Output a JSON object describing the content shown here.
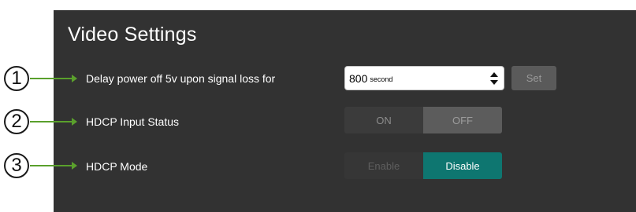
{
  "panel": {
    "title": "Video Settings"
  },
  "callouts": [
    "1",
    "2",
    "3"
  ],
  "rows": {
    "delay": {
      "label": "Delay power off 5v upon signal loss for",
      "value": "800",
      "unit": "second",
      "set_label": "Set"
    },
    "hdcp_status": {
      "label": "HDCP Input Status",
      "options": [
        "ON",
        "OFF"
      ],
      "selected": "OFF"
    },
    "hdcp_mode": {
      "label": "HDCP Mode",
      "options": [
        "Enable",
        "Disable"
      ],
      "selected": "Disable"
    }
  },
  "colors": {
    "panel_bg": "#323232",
    "accent_teal": "#0e7670",
    "callout_arrow": "#5aa02c"
  }
}
